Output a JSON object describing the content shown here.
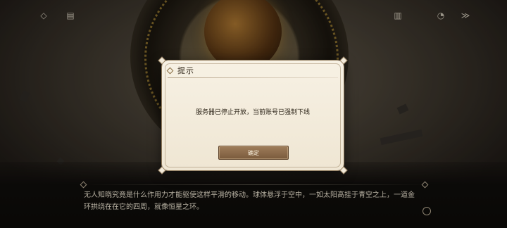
{
  "toolbar": {
    "icons": [
      {
        "name": "eye-icon",
        "glyph": "◇"
      },
      {
        "name": "log-icon",
        "glyph": "▤"
      },
      {
        "name": "book-icon",
        "glyph": "▥"
      },
      {
        "name": "auto-icon",
        "glyph": "◔"
      },
      {
        "name": "skip-icon",
        "glyph": "≫"
      }
    ]
  },
  "dialog": {
    "title": "提示",
    "message": "服务器已停止开放，当前账号已强制下线",
    "confirm_label": "确定"
  },
  "narration": {
    "text": "无人知晓究竟是什么作用力才能驱使这样平滑的移动。球体悬浮于空中，一如太阳高挂于青空之上，一道金环拱绕在在它的四周，就像恒星之环。"
  },
  "colors": {
    "dialog_bg": "#f7f1e4",
    "button_bg": "#8f6e4c",
    "narration_text": "#d8d0bf"
  }
}
